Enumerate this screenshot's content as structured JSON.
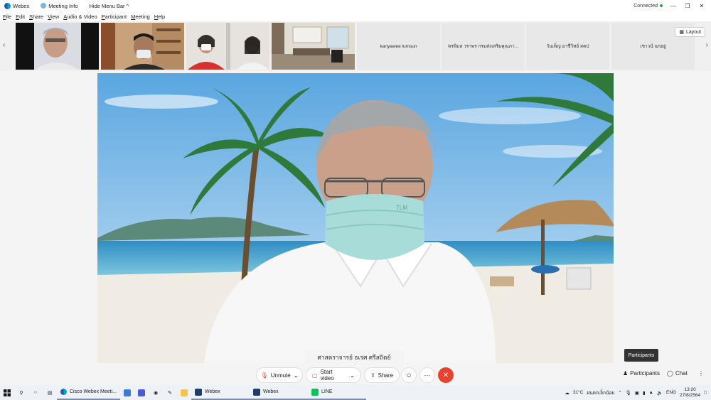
{
  "titlebar": {
    "app_name": "Webex",
    "meeting_info": "Meeting Info",
    "hide_menu": "Hide Menu Bar ^",
    "status": "Connected"
  },
  "menu": [
    "File",
    "Edit",
    "Share",
    "View",
    "Audio & Video",
    "Participant",
    "Meeting",
    "Help"
  ],
  "participants_strip": {
    "name_tiles": [
      "kanyawee lumsun",
      "พรพิมล วราพร กรมส่งเสริมคุณภา...",
      "วันเพ็ญ อาชีวิทย์ สคป",
      "เชาวน์ นกอยู่"
    ],
    "layout_label": "Layout"
  },
  "main_video": {
    "speaker_name": "ศาสตราจารย์ ธเรศ ศรีสถิตย์",
    "mask_text": "TLM"
  },
  "tooltip": "Participants",
  "controls": {
    "unmute": "Unmute",
    "start_video": "Start video",
    "share": "Share",
    "more": "···",
    "participants": "Participants",
    "chat": "Chat"
  },
  "taskbar": {
    "apps": [
      "Cisco Webex Meeti...",
      "Webex",
      "Webex",
      "LINE"
    ],
    "weather": "31°C",
    "weather_text": "ฝนตกเล็กน้อย",
    "lang": "ENG",
    "time": "13:20",
    "date": "27/8/2564"
  }
}
